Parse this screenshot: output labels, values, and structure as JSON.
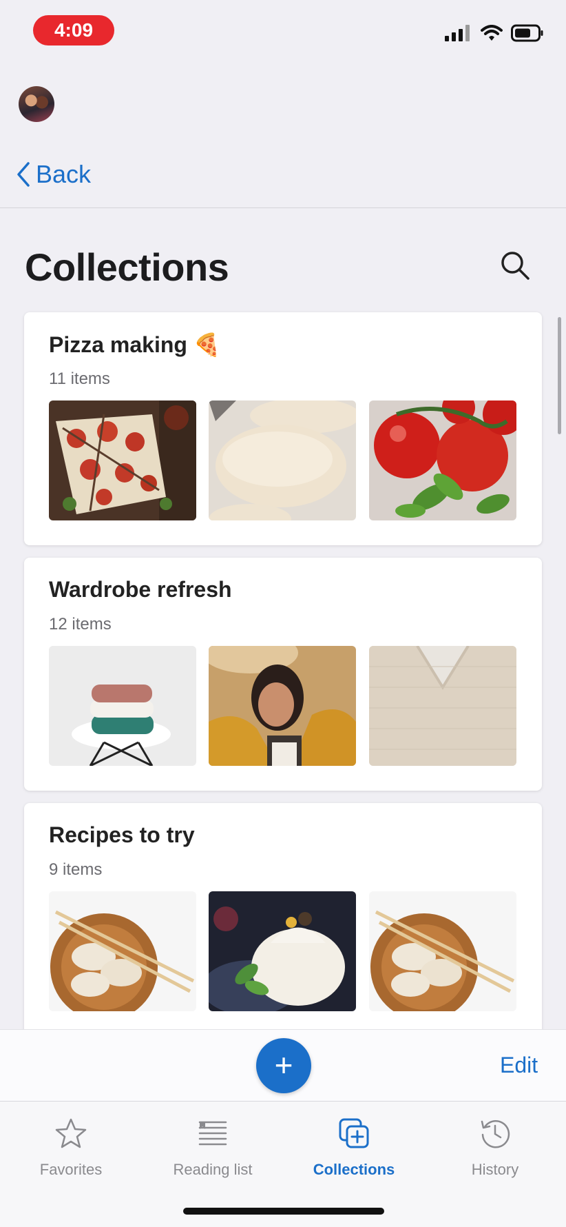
{
  "status": {
    "time": "4:09"
  },
  "nav": {
    "back_label": "Back"
  },
  "header": {
    "title": "Collections"
  },
  "collections": [
    {
      "title": "Pizza making",
      "emoji": "🍕",
      "count": "11 items"
    },
    {
      "title": "Wardrobe refresh",
      "emoji": "",
      "count": "12 items"
    },
    {
      "title": "Recipes to try",
      "emoji": "",
      "count": "9 items"
    }
  ],
  "actions": {
    "add_label": "+",
    "edit_label": "Edit"
  },
  "tabs": [
    {
      "label": "Favorites",
      "icon": "star-icon"
    },
    {
      "label": "Reading list",
      "icon": "reading-list-icon"
    },
    {
      "label": "Collections",
      "icon": "collections-icon",
      "active": true
    },
    {
      "label": "History",
      "icon": "history-icon"
    }
  ],
  "colors": {
    "accent": "#1b6fc9",
    "time_pill": "#e8282d",
    "background": "#f0eff4"
  }
}
